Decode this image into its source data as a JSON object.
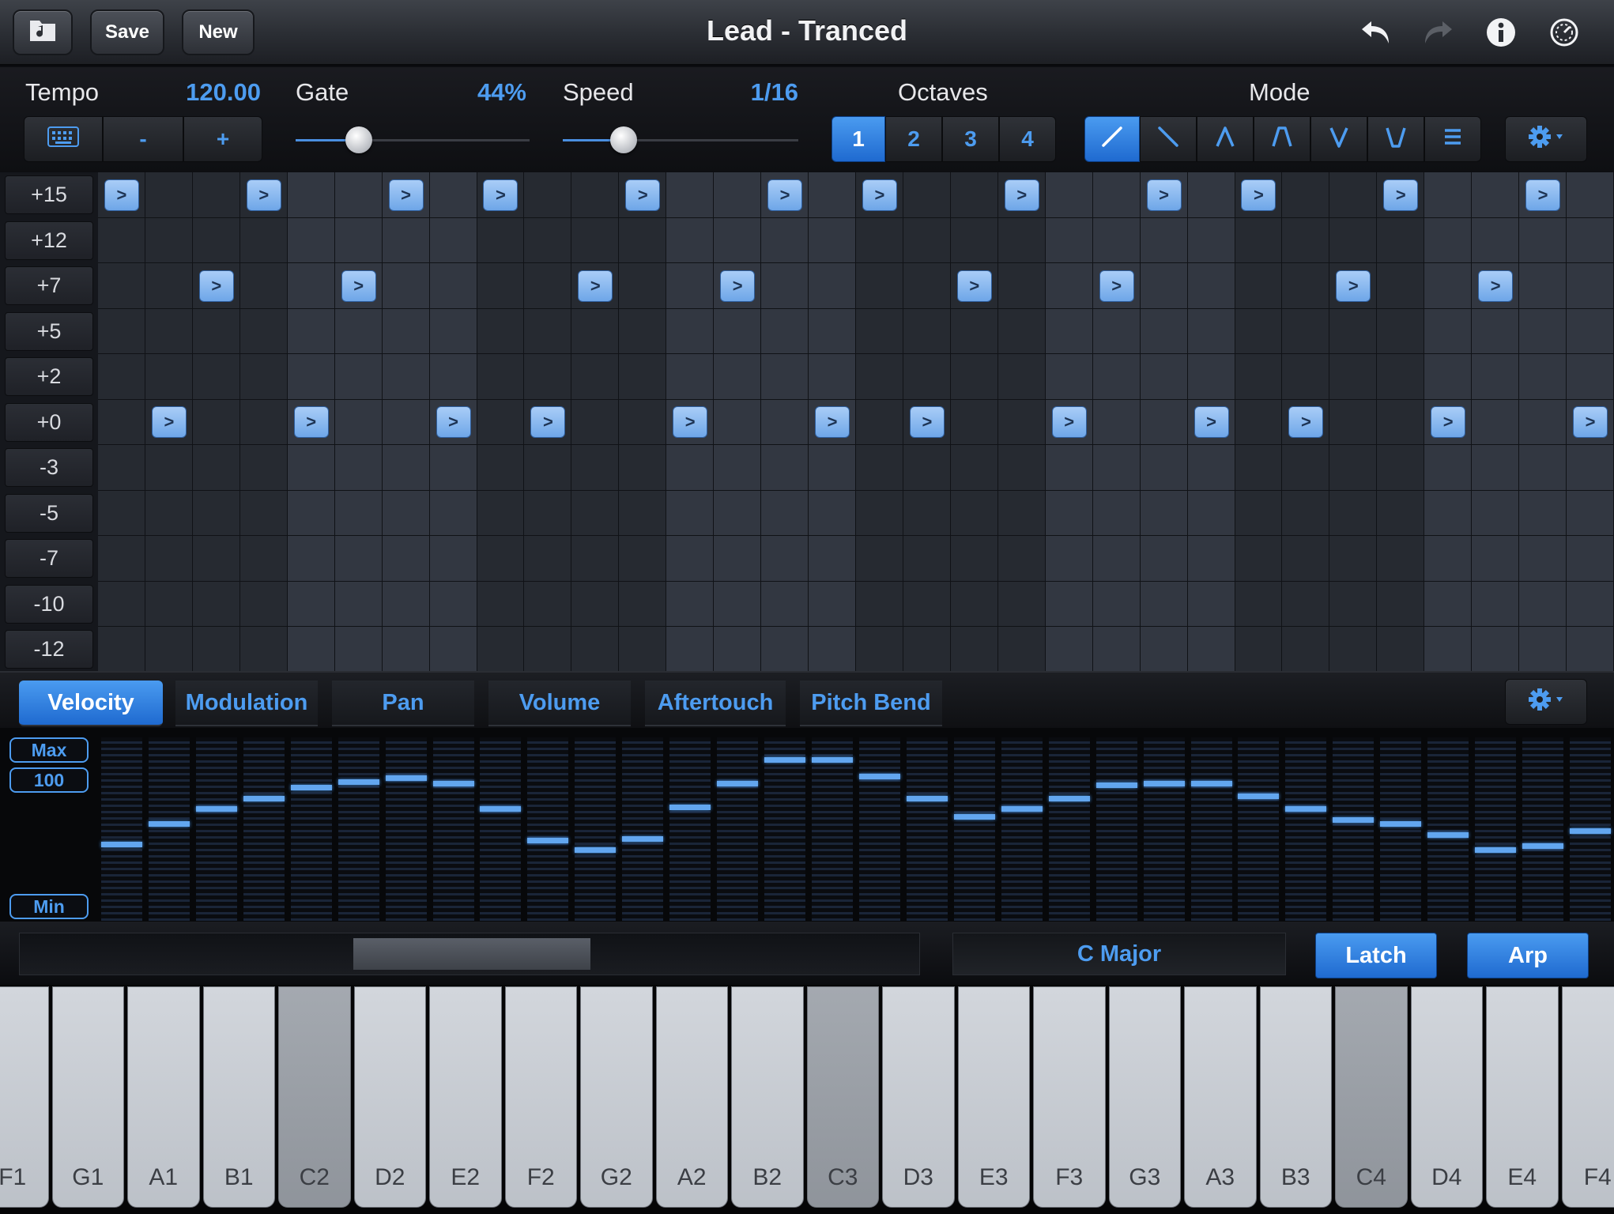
{
  "titlebar": {
    "title": "Lead - Tranced",
    "save_label": "Save",
    "new_label": "New",
    "icons": [
      "browser-icon",
      "undo-icon",
      "redo-icon",
      "info-icon",
      "settings-dial-icon"
    ]
  },
  "controls": {
    "tempo": {
      "label": "Tempo",
      "value": "120.00",
      "buttons": [
        "-",
        "+"
      ]
    },
    "gate": {
      "label": "Gate",
      "value": "44%",
      "level": 0.27
    },
    "speed": {
      "label": "Speed",
      "value": "1/16",
      "level": 0.26
    },
    "octaves": {
      "label": "Octaves",
      "options": [
        "1",
        "2",
        "3",
        "4"
      ],
      "selected": "1"
    },
    "mode": {
      "label": "Mode",
      "options": [
        "up",
        "down",
        "up-down",
        "up-down-inclusive",
        "down-up",
        "down-up-inclusive",
        "as-played"
      ],
      "selected": "up"
    }
  },
  "grid": {
    "rows": [
      "+15",
      "+12",
      "+7",
      "+5",
      "+2",
      "+0",
      "-3",
      "-5",
      "-7",
      "-10",
      "-12"
    ],
    "steps": 32,
    "note_glyph": ">",
    "notes": {
      "+15": [
        0,
        3,
        6,
        8,
        11,
        14,
        16,
        19,
        22,
        24,
        27,
        30
      ],
      "+7": [
        2,
        5,
        10,
        13,
        18,
        21,
        26,
        29
      ],
      "+0": [
        1,
        4,
        7,
        9,
        12,
        15,
        17,
        20,
        23,
        25,
        28,
        31
      ]
    }
  },
  "tabs": {
    "items": [
      "Velocity",
      "Modulation",
      "Pan",
      "Volume",
      "Aftertouch",
      "Pitch Bend"
    ],
    "active": "Velocity"
  },
  "velocity": {
    "max_label": "Max",
    "value_label": "100",
    "min_label": "Min",
    "levels": [
      0.42,
      0.53,
      0.61,
      0.67,
      0.73,
      0.76,
      0.78,
      0.75,
      0.61,
      0.44,
      0.39,
      0.45,
      0.62,
      0.75,
      0.88,
      0.88,
      0.79,
      0.67,
      0.57,
      0.61,
      0.67,
      0.74,
      0.75,
      0.75,
      0.68,
      0.61,
      0.55,
      0.53,
      0.47,
      0.39,
      0.41,
      0.49
    ]
  },
  "keyboard_strip": {
    "scale": "C Major",
    "latch_label": "Latch",
    "arp_label": "Arp"
  },
  "piano": {
    "keys": [
      "F1",
      "G1",
      "A1",
      "B1",
      "C2",
      "D2",
      "E2",
      "F2",
      "G2",
      "A2",
      "B2",
      "C3",
      "D3",
      "E3",
      "F3",
      "G3",
      "A3",
      "B3",
      "C4",
      "D4",
      "E4",
      "F4"
    ]
  }
}
